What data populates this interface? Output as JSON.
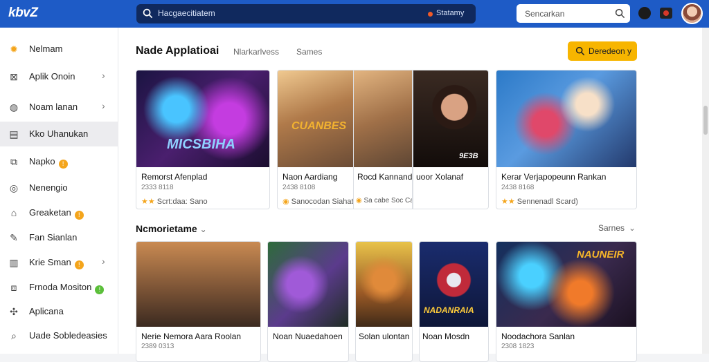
{
  "app": {
    "logo": "kbvZ"
  },
  "topbar": {
    "search_text": "Hacgaecitiatem",
    "status": "Statamy",
    "search2_placeholder": "Sencarkan",
    "search_icon": "search-icon",
    "bell_icon": "notification-icon",
    "camera_icon": "camera-icon",
    "accent": "#1e5bc6"
  },
  "sidebar": {
    "items": [
      {
        "label": "Nelmam",
        "icon": "sun-icon",
        "chevron": false,
        "badge": ""
      },
      {
        "label": "Aplik Onoin",
        "icon": "apps-icon",
        "chevron": true,
        "badge": ""
      },
      {
        "label": "Noam lanan",
        "icon": "chat-icon",
        "chevron": true,
        "badge": ""
      },
      {
        "label": "Kko Uhanukan",
        "icon": "monitor-icon",
        "chevron": false,
        "badge": ""
      },
      {
        "label": "Napko",
        "icon": "box-icon",
        "chevron": false,
        "badge": "!"
      },
      {
        "label": "Nenengio",
        "icon": "settings-icon",
        "chevron": false,
        "badge": ""
      },
      {
        "label": "Greaketan",
        "icon": "store-icon",
        "chevron": false,
        "badge": "!"
      },
      {
        "label": "Fan Sianlan",
        "icon": "pen-icon",
        "chevron": false,
        "badge": ""
      },
      {
        "label": "Krie Sman",
        "icon": "chart-icon",
        "chevron": true,
        "badge": "!"
      },
      {
        "label": "Frnoda Mositon",
        "icon": "gift-icon",
        "chevron": false,
        "badge": "!"
      },
      {
        "label": "Aplicana",
        "icon": "puzzle-icon",
        "chevron": false,
        "badge": ""
      },
      {
        "label": "Uade Sobledeasies",
        "icon": "search-icon",
        "chevron": false,
        "badge": ""
      }
    ]
  },
  "section1": {
    "title": "Nade Applatioai",
    "tabs": [
      "Nlarkarlvess",
      "Sames"
    ],
    "cta_label": "Deredeon y",
    "cards": [
      {
        "title": "Remorst Afenplad",
        "meta": "2333 8118",
        "rating": "Scrt:daa: Sano",
        "art": "MICSBIHA"
      },
      {
        "title": "Naon Aardiang",
        "meta": "2438 8108",
        "rating": "Sanocodan Siahat",
        "art": "CUANBES"
      },
      {
        "title": "Rocd Kannand",
        "meta": "",
        "rating": "Sa cabe Soc Catru)",
        "art": ""
      },
      {
        "title": "uoor Xolanaf",
        "meta": "",
        "rating": "",
        "art": "9E3B"
      },
      {
        "title": "Kerar Verjapopeunn Rankan",
        "meta": "2438 8168",
        "rating": "Sennenadl Scard)",
        "art": ""
      }
    ]
  },
  "section2": {
    "title": "Ncmorietame",
    "sort_label": "Sarnes",
    "cards": [
      {
        "title": "Nerie Nemora Aara Roolan",
        "meta": "2389 0313",
        "art": ""
      },
      {
        "title": "Noan Nuaedahoen",
        "meta": "",
        "art": ""
      },
      {
        "title": "Solan ulontan",
        "meta": "",
        "art": ""
      },
      {
        "title": "Noan Mosdn",
        "meta": "",
        "art": "NADANRAIA"
      },
      {
        "title": "Noodachora Sanlan",
        "meta": "2308 1823",
        "art": "NAUNEIR"
      }
    ]
  }
}
